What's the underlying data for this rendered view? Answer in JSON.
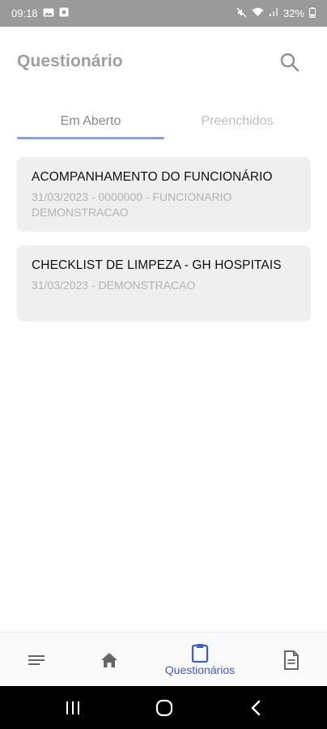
{
  "status_bar": {
    "time": "09:18",
    "battery": "32%"
  },
  "header": {
    "title": "Questionário",
    "search_icon": "search-icon"
  },
  "tabs": [
    {
      "label": "Em Aberto",
      "active": true
    },
    {
      "label": "Preenchidos",
      "active": false
    }
  ],
  "cards": [
    {
      "title": "ACOMPANHAMENTO DO FUNCIONÁRIO",
      "subtitle": "31/03/2023 - 0000000 - FUNCIONARIO DEMONSTRACAO"
    },
    {
      "title": "CHECKLIST DE LIMPEZA - GH HOSPITAIS",
      "subtitle": "31/03/2023 - DEMONSTRACAO"
    }
  ],
  "bottom_nav": {
    "items": [
      {
        "icon": "menu-icon"
      },
      {
        "icon": "home-icon"
      },
      {
        "icon": "clipboard-icon",
        "label": "Questionários",
        "active": true
      },
      {
        "icon": "document-icon"
      }
    ]
  },
  "colors": {
    "accent": "#3c5bd6",
    "tab_indicator": "#7f9ef0",
    "card_bg": "#efefef",
    "status_bar_bg": "#9a9a9a"
  }
}
